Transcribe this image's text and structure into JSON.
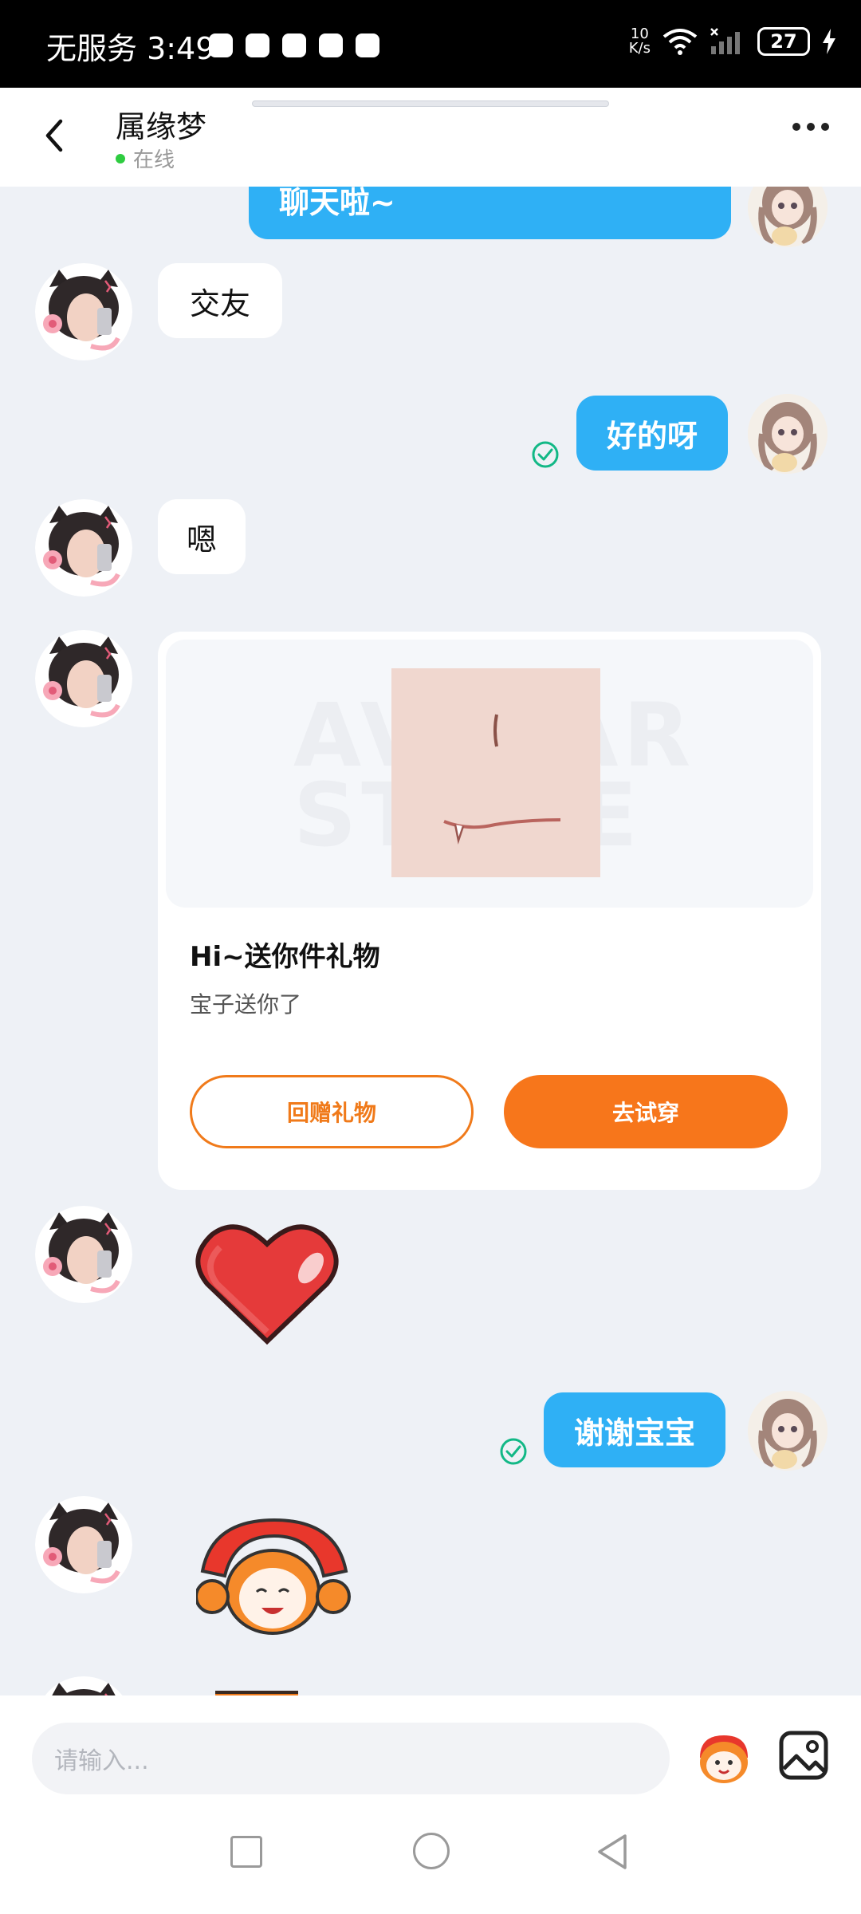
{
  "status_bar": {
    "carrier_time": "无服务 3:49",
    "net_speed_value": "10",
    "net_speed_unit": "K/s",
    "battery": "27"
  },
  "header": {
    "contact_name": "属缘梦",
    "status": "在线"
  },
  "messages": {
    "m0_text": "聊天啦~",
    "m1_text": "交友",
    "m2_text": "好的呀",
    "m3_text": "嗯",
    "m6_text": "谢谢宝宝"
  },
  "gift": {
    "title": "Hi~送你件礼物",
    "subtitle": "宝子送你了",
    "watermark": "AVATAR STORE",
    "return_button": "回赠礼物",
    "try_button": "去试穿"
  },
  "composer": {
    "placeholder": "请输入..."
  },
  "colors": {
    "bubble_self": "#2fb0f5",
    "accent_orange": "#f7761b",
    "online": "#2ecc40",
    "read_check": "#12b886"
  }
}
